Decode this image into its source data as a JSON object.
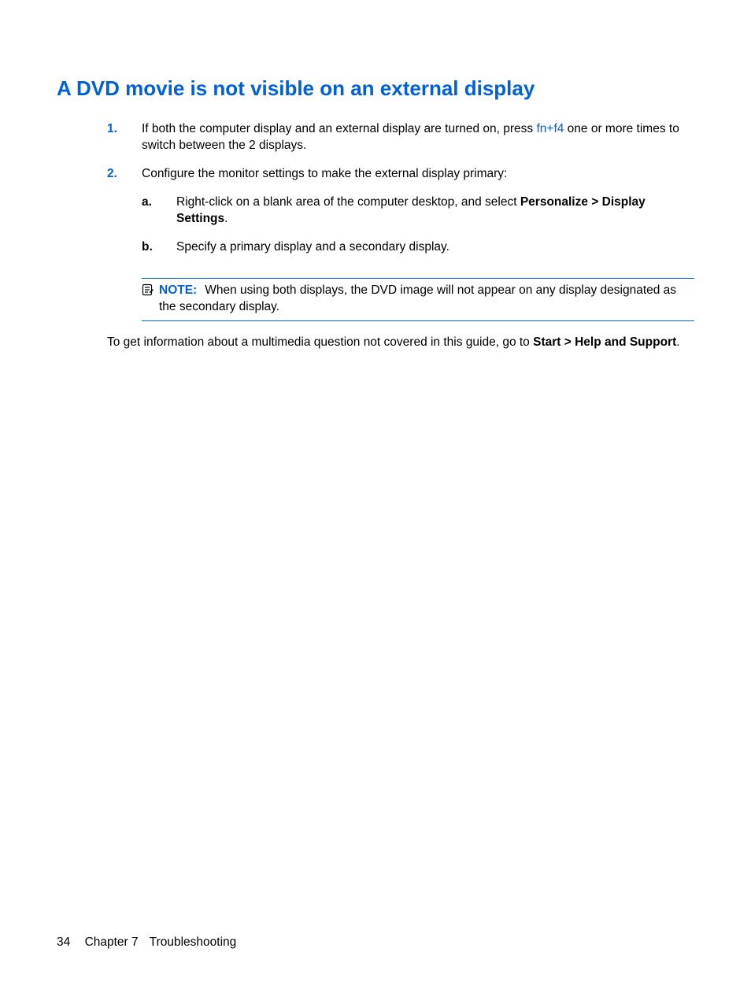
{
  "heading": "A DVD movie is not visible on an external display",
  "steps": {
    "s1": {
      "marker": "1.",
      "pre": "If both the computer display and an external display are turned on, press ",
      "key": "fn+f4",
      "post": " one or more times to switch between the 2 displays."
    },
    "s2": {
      "marker": "2.",
      "text": "Configure the monitor settings to make the external display primary:",
      "sub": {
        "a": {
          "marker": "a.",
          "pre": "Right-click on a blank area of the computer desktop, and select ",
          "bold": "Personalize > Display Settings",
          "post": "."
        },
        "b": {
          "marker": "b.",
          "text": "Specify a primary display and a secondary display."
        }
      }
    }
  },
  "note": {
    "label": "NOTE:",
    "text": "When using both displays, the DVD image will not appear on any display designated as the secondary display."
  },
  "afterNote": {
    "pre": "To get information about a multimedia question not covered in this guide, go to ",
    "bold": "Start > Help and Support",
    "post": "."
  },
  "footer": {
    "pageNumber": "34",
    "chapter": "Chapter 7",
    "title": "Troubleshooting"
  }
}
